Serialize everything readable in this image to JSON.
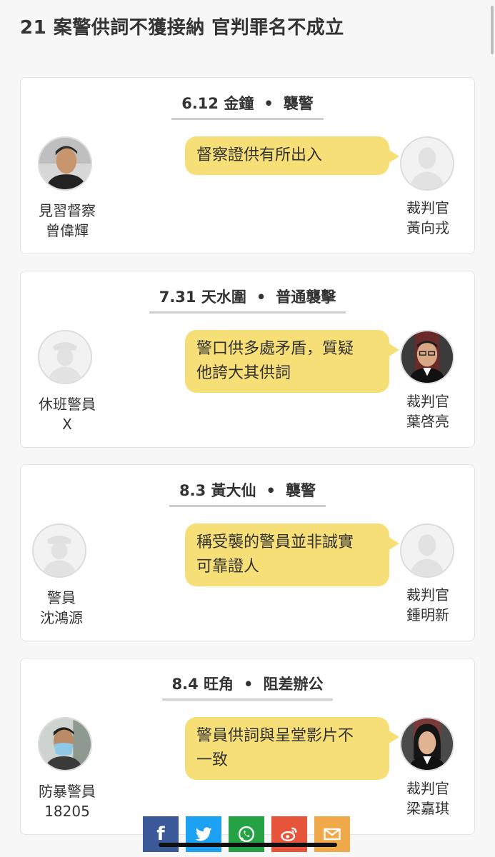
{
  "headline": "21 案警供詞不獲接納 官判罪名不成立",
  "cards": [
    {
      "date": "6.12 金鐘",
      "charge": "襲警",
      "quote_lines": [
        "督察證供有所出入"
      ],
      "left_role": "見習督察",
      "left_name": "曾偉輝",
      "right_role": "裁判官",
      "right_name": "黃向戎"
    },
    {
      "date": "7.31 天水圍",
      "charge": "普通襲擊",
      "quote_lines": [
        "警口供多處矛盾，質疑",
        "他誇大其供詞"
      ],
      "left_role": "休班警員",
      "left_name": "X",
      "right_role": "裁判官",
      "right_name": "葉啓亮"
    },
    {
      "date": "8.3 黃大仙",
      "charge": "襲警",
      "quote_lines": [
        "稱受襲的警員並非誠實",
        "可靠證人"
      ],
      "left_role": "警員",
      "left_name": "沈鴻源",
      "right_role": "裁判官",
      "right_name": "鍾明新"
    },
    {
      "date": "8.4 旺角",
      "charge": "阻差辦公",
      "quote_lines": [
        "警員供詞與呈堂影片不",
        "一致"
      ],
      "left_role": "防暴警員",
      "left_name": "18205",
      "right_role": "裁判官",
      "right_name": "梁嘉琪"
    }
  ],
  "share_buttons": [
    {
      "name": "facebook",
      "color": "#3b5998"
    },
    {
      "name": "twitter",
      "color": "#1da1f2"
    },
    {
      "name": "whatsapp",
      "color": "#25a244"
    },
    {
      "name": "weibo",
      "color": "#e6543b"
    },
    {
      "name": "email",
      "color": "#f0a94a"
    }
  ],
  "colors": {
    "bubble": "#f7df78",
    "card_bg": "#ffffff",
    "page_bg": "#f7f7f7"
  }
}
